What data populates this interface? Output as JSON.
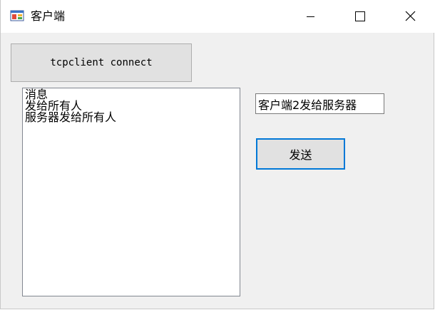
{
  "window": {
    "title": "客户端"
  },
  "main": {
    "connect_button_label": "tcpclient connect",
    "messages": [
      "消息",
      "发给所有人",
      "服务器发给所有人"
    ],
    "message_input_value": "客户端2发给服务器",
    "send_button_label": "发送"
  },
  "colors": {
    "focus_border": "#0078d7",
    "button_face": "#e1e1e1",
    "window_background": "#f0f0f0"
  }
}
